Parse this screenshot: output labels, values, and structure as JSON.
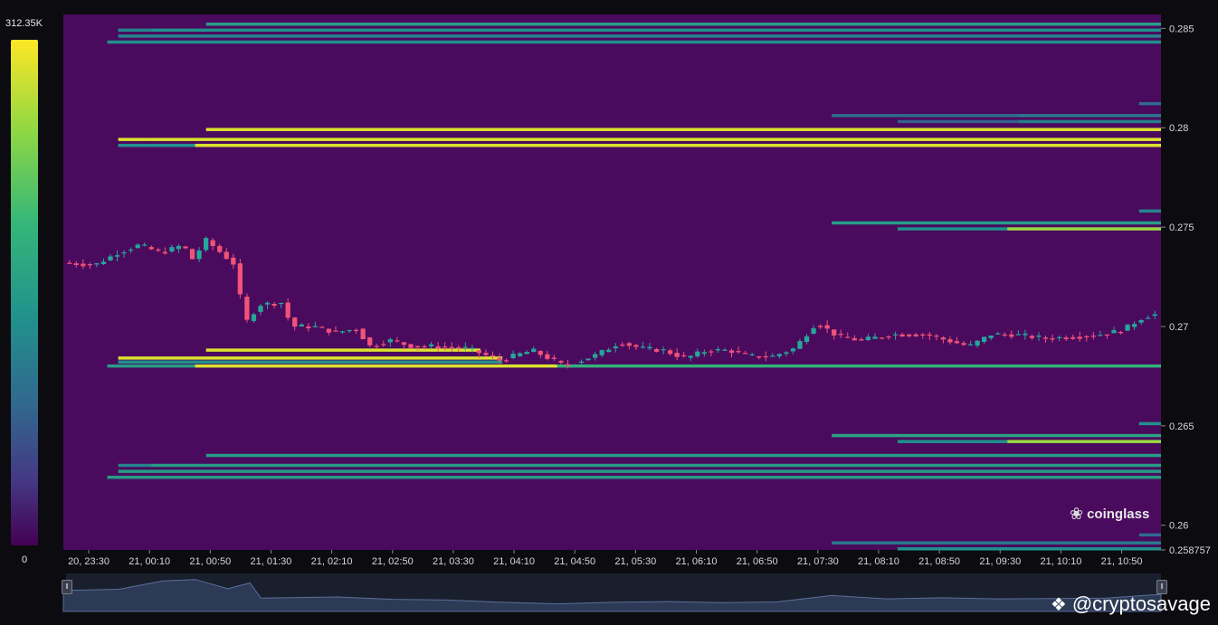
{
  "colorbar": {
    "max_label": "312.35K",
    "min_label": "0"
  },
  "branding": {
    "watermark": "coinglass",
    "handle": "@cryptosavage",
    "watermark_icon": "owl-icon",
    "handle_icon": "binance-diamond-icon"
  },
  "colors": {
    "background": "#4a0a5e",
    "page": "#0b0b10",
    "up": "#26a69a",
    "down": "#ef5378",
    "scale": [
      "#440154",
      "#443983",
      "#31688e",
      "#21918c",
      "#35b779",
      "#90d743",
      "#fde725"
    ]
  },
  "chart_data": {
    "type": "heatmap",
    "ylim": [
      0.258757,
      0.2857
    ],
    "yticks": [
      {
        "label": "0.285",
        "value": 0.285
      },
      {
        "label": "0.28",
        "value": 0.28
      },
      {
        "label": "0.275",
        "value": 0.275
      },
      {
        "label": "0.27",
        "value": 0.27
      },
      {
        "label": "0.265",
        "value": 0.265
      },
      {
        "label": "0.26",
        "value": 0.26
      },
      {
        "label": "0.258757",
        "value": 0.258757
      }
    ],
    "time_start": "20, 23:30",
    "time_end": "21, 11:20",
    "xtick_labels": [
      "20, 23:30",
      "21, 00:10",
      "21, 00:50",
      "21, 01:30",
      "21, 02:10",
      "21, 02:50",
      "21, 03:30",
      "21, 04:10",
      "21, 04:50",
      "21, 05:30",
      "21, 06:10",
      "21, 06:50",
      "21, 07:30",
      "21, 08:10",
      "21, 08:50",
      "21, 09:30",
      "21, 10:10",
      "21, 10:50"
    ],
    "liquidity_bands": [
      {
        "price": 0.2852,
        "segments": [
          [
            0.0,
            0.13,
            0
          ],
          [
            0.13,
            1.0,
            0.55
          ]
        ]
      },
      {
        "price": 0.2849,
        "segments": [
          [
            0.05,
            0.08,
            0.45
          ],
          [
            0.08,
            1.0,
            0.5
          ]
        ]
      },
      {
        "price": 0.2846,
        "segments": [
          [
            0.05,
            1.0,
            0.45
          ]
        ]
      },
      {
        "price": 0.2843,
        "segments": [
          [
            0.04,
            1.0,
            0.5
          ]
        ]
      },
      {
        "price": 0.2812,
        "segments": [
          [
            0.98,
            1.0,
            0.35
          ]
        ]
      },
      {
        "price": 0.2806,
        "segments": [
          [
            0.7,
            0.87,
            0.35
          ],
          [
            0.87,
            1.0,
            0.4
          ]
        ]
      },
      {
        "price": 0.2803,
        "segments": [
          [
            0.76,
            0.87,
            0.3
          ],
          [
            0.87,
            1.0,
            0.42
          ]
        ]
      },
      {
        "price": 0.2799,
        "segments": [
          [
            0.13,
            1.0,
            0.95
          ]
        ]
      },
      {
        "price": 0.2794,
        "segments": [
          [
            0.05,
            0.08,
            0.95
          ],
          [
            0.08,
            1.0,
            0.95
          ]
        ]
      },
      {
        "price": 0.2791,
        "segments": [
          [
            0.05,
            0.12,
            0.5
          ],
          [
            0.12,
            1.0,
            0.95
          ]
        ]
      },
      {
        "price": 0.2758,
        "segments": [
          [
            0.98,
            1.0,
            0.45
          ]
        ]
      },
      {
        "price": 0.2752,
        "segments": [
          [
            0.7,
            1.0,
            0.55
          ]
        ]
      },
      {
        "price": 0.2749,
        "segments": [
          [
            0.76,
            0.86,
            0.5
          ],
          [
            0.86,
            1.0,
            0.85
          ]
        ]
      },
      {
        "price": 0.2688,
        "segments": [
          [
            0.13,
            0.38,
            0.95
          ]
        ]
      },
      {
        "price": 0.2684,
        "segments": [
          [
            0.05,
            0.4,
            0.95
          ]
        ]
      },
      {
        "price": 0.2682,
        "segments": [
          [
            0.05,
            0.4,
            0.5
          ]
        ]
      },
      {
        "price": 0.268,
        "segments": [
          [
            0.04,
            0.12,
            0.55
          ],
          [
            0.12,
            0.45,
            0.95
          ],
          [
            0.45,
            1.0,
            0.65
          ]
        ]
      },
      {
        "price": 0.2651,
        "segments": [
          [
            0.98,
            1.0,
            0.5
          ]
        ]
      },
      {
        "price": 0.2645,
        "segments": [
          [
            0.7,
            1.0,
            0.58
          ]
        ]
      },
      {
        "price": 0.2642,
        "segments": [
          [
            0.76,
            0.86,
            0.5
          ],
          [
            0.86,
            1.0,
            0.85
          ]
        ]
      },
      {
        "price": 0.2635,
        "segments": [
          [
            0.13,
            1.0,
            0.55
          ]
        ]
      },
      {
        "price": 0.263,
        "segments": [
          [
            0.05,
            0.08,
            0.45
          ],
          [
            0.08,
            1.0,
            0.55
          ]
        ]
      },
      {
        "price": 0.2627,
        "segments": [
          [
            0.05,
            1.0,
            0.55
          ]
        ]
      },
      {
        "price": 0.2624,
        "segments": [
          [
            0.04,
            1.0,
            0.55
          ]
        ]
      },
      {
        "price": 0.2595,
        "segments": [
          [
            0.98,
            1.0,
            0.35
          ]
        ]
      },
      {
        "price": 0.2591,
        "segments": [
          [
            0.7,
            1.0,
            0.4
          ]
        ]
      },
      {
        "price": 0.2588,
        "segments": [
          [
            0.76,
            1.0,
            0.5
          ]
        ]
      }
    ],
    "candle_path": [
      [
        0.0,
        0.2732
      ],
      [
        0.03,
        0.2731
      ],
      [
        0.05,
        0.2737
      ],
      [
        0.07,
        0.2741
      ],
      [
        0.09,
        0.2737
      ],
      [
        0.11,
        0.2741
      ],
      [
        0.12,
        0.2733
      ],
      [
        0.13,
        0.2744
      ],
      [
        0.145,
        0.2737
      ],
      [
        0.16,
        0.273
      ],
      [
        0.165,
        0.27
      ],
      [
        0.18,
        0.2711
      ],
      [
        0.2,
        0.2712
      ],
      [
        0.21,
        0.27
      ],
      [
        0.23,
        0.27
      ],
      [
        0.25,
        0.2697
      ],
      [
        0.27,
        0.2699
      ],
      [
        0.28,
        0.269
      ],
      [
        0.3,
        0.2693
      ],
      [
        0.32,
        0.269
      ],
      [
        0.34,
        0.269
      ],
      [
        0.37,
        0.2689
      ],
      [
        0.39,
        0.2685
      ],
      [
        0.4,
        0.2683
      ],
      [
        0.43,
        0.2688
      ],
      [
        0.46,
        0.268
      ],
      [
        0.49,
        0.2686
      ],
      [
        0.51,
        0.2692
      ],
      [
        0.53,
        0.2689
      ],
      [
        0.55,
        0.2688
      ],
      [
        0.57,
        0.2684
      ],
      [
        0.59,
        0.2688
      ],
      [
        0.61,
        0.2688
      ],
      [
        0.63,
        0.2685
      ],
      [
        0.65,
        0.2685
      ],
      [
        0.67,
        0.2689
      ],
      [
        0.69,
        0.2702
      ],
      [
        0.71,
        0.2695
      ],
      [
        0.73,
        0.2693
      ],
      [
        0.76,
        0.2696
      ],
      [
        0.79,
        0.2696
      ],
      [
        0.81,
        0.2693
      ],
      [
        0.83,
        0.269
      ],
      [
        0.85,
        0.2696
      ],
      [
        0.87,
        0.2696
      ],
      [
        0.9,
        0.2694
      ],
      [
        0.93,
        0.2695
      ],
      [
        0.95,
        0.2696
      ],
      [
        0.97,
        0.2698
      ],
      [
        0.99,
        0.2705
      ],
      [
        1.0,
        0.2706
      ]
    ],
    "candle_count": 160,
    "navigator_path": [
      [
        0.0,
        0.55
      ],
      [
        0.05,
        0.58
      ],
      [
        0.09,
        0.8
      ],
      [
        0.12,
        0.84
      ],
      [
        0.15,
        0.6
      ],
      [
        0.17,
        0.75
      ],
      [
        0.18,
        0.35
      ],
      [
        0.25,
        0.38
      ],
      [
        0.3,
        0.32
      ],
      [
        0.35,
        0.3
      ],
      [
        0.4,
        0.24
      ],
      [
        0.45,
        0.2
      ],
      [
        0.5,
        0.24
      ],
      [
        0.55,
        0.26
      ],
      [
        0.6,
        0.23
      ],
      [
        0.65,
        0.25
      ],
      [
        0.7,
        0.42
      ],
      [
        0.75,
        0.33
      ],
      [
        0.8,
        0.36
      ],
      [
        0.85,
        0.33
      ],
      [
        0.9,
        0.34
      ],
      [
        0.95,
        0.35
      ],
      [
        1.0,
        0.45
      ]
    ]
  }
}
